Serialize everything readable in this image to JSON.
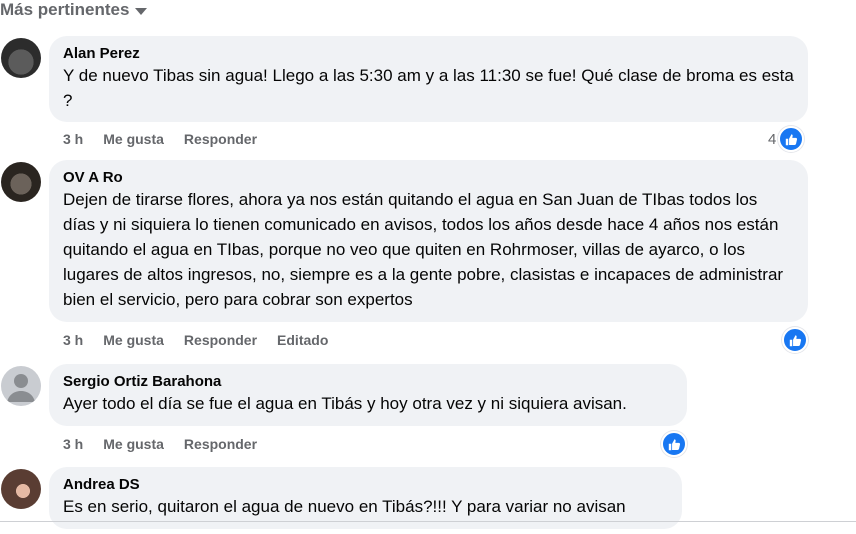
{
  "sort": {
    "label": "Más pertinentes"
  },
  "comments": [
    {
      "author": "Alan Perez",
      "text": "Y de nuevo Tibas sin agua! Llego a las 5:30 am y a las 11:30 se fue! Qué clase de broma es esta ?",
      "time": "3 h",
      "like": "Me gusta",
      "reply": "Responder",
      "reaction_count": "4"
    },
    {
      "author": "OV A Ro",
      "text": "Dejen de tirarse flores, ahora ya nos están quitando el agua en San Juan de TIbas todos los días y ni siquiera lo tienen comunicado en avisos, todos los años desde hace 4 años nos están quitando el agua en TIbas, porque no veo que quiten en Rohrmoser, villas de ayarco, o los lugares de altos ingresos, no, siempre es a la gente pobre, clasistas e incapaces de administrar bien el servicio, pero para cobrar son expertos",
      "time": "3 h",
      "like": "Me gusta",
      "reply": "Responder",
      "edited": "Editado"
    },
    {
      "author": "Sergio Ortiz Barahona",
      "text": "Ayer todo el día se fue el agua en Tibás y hoy otra vez y ni siquiera avisan.",
      "time": "3 h",
      "like": "Me gusta",
      "reply": "Responder"
    },
    {
      "author": "Andrea DS",
      "text": "Es en serio, quitaron el agua de nuevo en Tibás?!!! Y para variar no avisan"
    }
  ],
  "icons": {
    "sort": "chevron-down-icon",
    "reaction": "like-icon"
  },
  "colors": {
    "accent": "#1877f2",
    "bubble": "#f0f2f5",
    "muted": "#65676b"
  }
}
